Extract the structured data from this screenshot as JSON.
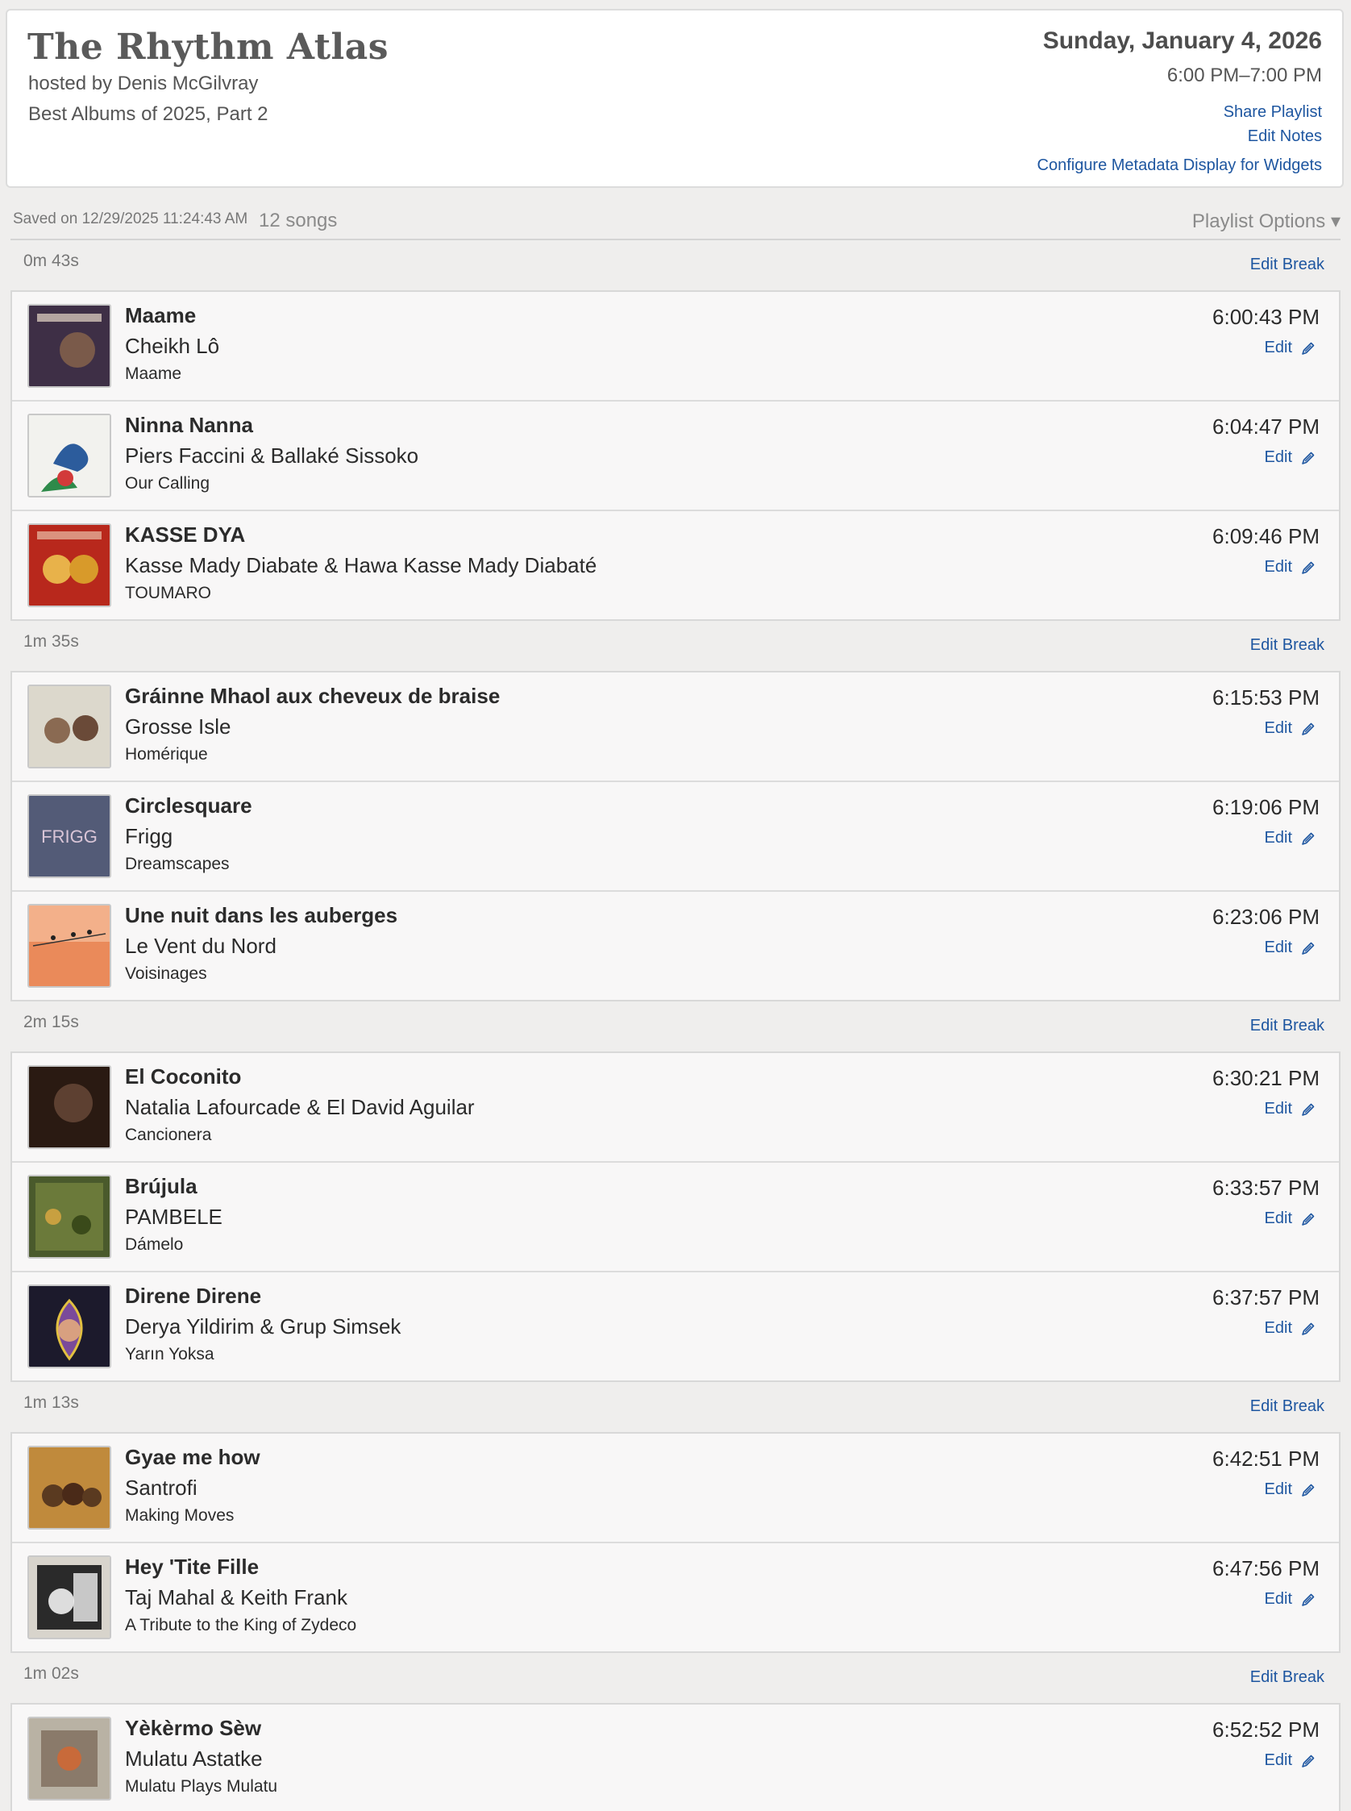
{
  "header": {
    "title": "The Rhythm Atlas",
    "host": "hosted by Denis McGilvray",
    "episode": "Best Albums of 2025, Part 2",
    "date": "Sunday, January 4, 2026",
    "time": "6:00 PM–7:00 PM",
    "share_label": "Share Playlist",
    "edit_notes_label": "Edit Notes",
    "configure_label": "Configure Metadata Display for Widgets"
  },
  "meta": {
    "saved": "Saved on 12/29/2025 11:24:43 AM",
    "count": "12 songs",
    "options_label": "Playlist Options ▾"
  },
  "labels": {
    "edit": "Edit",
    "edit_break": "Edit Break"
  },
  "breaks": [
    "0m 43s",
    "1m 35s",
    "2m 15s",
    "1m 13s",
    "1m 02s"
  ],
  "songs": [
    {
      "title": "Maame",
      "artist": "Cheikh Lô",
      "album": "Maame",
      "time": "6:00:43 PM",
      "art_color": "#3e2f46"
    },
    {
      "title": "Ninna Nanna",
      "artist": "Piers Faccini & Ballaké Sissoko",
      "album": "Our Calling",
      "time": "6:04:47 PM",
      "art_color": "#f2f2ee"
    },
    {
      "title": "KASSE DYA",
      "artist": "Kasse Mady Diabate & Hawa Kasse Mady Diabaté",
      "album": "TOUMARO",
      "time": "6:09:46 PM",
      "art_color": "#b8281c"
    },
    {
      "title": "Gráinne Mhaol aux cheveux de braise",
      "artist": "Grosse Isle",
      "album": "Homérique",
      "time": "6:15:53 PM",
      "art_color": "#dcd8cc"
    },
    {
      "title": "Circlesquare",
      "artist": "Frigg",
      "album": "Dreamscapes",
      "time": "6:19:06 PM",
      "art_color": "#2d5b70"
    },
    {
      "title": "Une nuit dans les auberges",
      "artist": "Le Vent du Nord",
      "album": "Voisinages",
      "time": "6:23:06 PM",
      "art_color": "#ea8a5a"
    },
    {
      "title": "El Coconito",
      "artist": "Natalia Lafourcade & El David Aguilar",
      "album": "Cancionera",
      "time": "6:30:21 PM",
      "art_color": "#2a1a12"
    },
    {
      "title": "Brújula",
      "artist": "PAMBELE",
      "album": "Dámelo",
      "time": "6:33:57 PM",
      "art_color": "#4a5a2c"
    },
    {
      "title": "Direne Direne",
      "artist": "Derya Yildirim & Grup Simsek",
      "album": "Yarın Yoksa",
      "time": "6:37:57 PM",
      "art_color": "#1c1a2c"
    },
    {
      "title": "Gyae me how",
      "artist": "Santrofi",
      "album": "Making Moves",
      "time": "6:42:51 PM",
      "art_color": "#c08a3c"
    },
    {
      "title": "Hey 'Tite Fille",
      "artist": "Taj Mahal & Keith Frank",
      "album": "A Tribute to the King of Zydeco",
      "time": "6:47:56 PM",
      "art_color": "#d8d4cc"
    },
    {
      "title": "Yèkèrmo Sèw",
      "artist": "Mulatu Astatke",
      "album": "Mulatu Plays Mulatu",
      "time": "6:52:52 PM",
      "art_color": "#b9b2a4"
    }
  ]
}
